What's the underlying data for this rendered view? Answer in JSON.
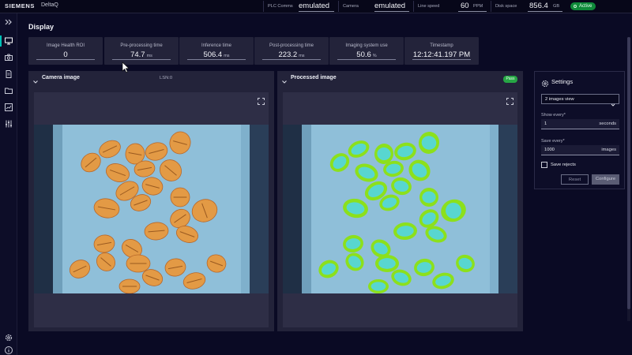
{
  "header": {
    "brand": "SIEMENS",
    "app_name": "DeltaQ",
    "stats": [
      {
        "label": "PLC Comms",
        "value": "emulated",
        "unit": ""
      },
      {
        "label": "Camera",
        "value": "emulated",
        "unit": ""
      },
      {
        "label": "Line speed",
        "value": "60",
        "unit": "PPM"
      },
      {
        "label": "Disk space",
        "value": "856.4",
        "unit": "GB"
      }
    ],
    "status_badge": "Active"
  },
  "sidebar": {
    "items": [
      {
        "icon": "expand-icon"
      },
      {
        "icon": "monitor-icon",
        "active": true
      },
      {
        "icon": "camera-icon"
      },
      {
        "icon": "document-icon"
      },
      {
        "icon": "folder-icon"
      },
      {
        "icon": "chart-icon"
      },
      {
        "icon": "sliders-icon"
      }
    ],
    "bottom_items": [
      {
        "icon": "gear-icon"
      },
      {
        "icon": "info-icon"
      }
    ]
  },
  "page": {
    "title": "Display"
  },
  "metrics": [
    {
      "label": "Image Health ROI",
      "value": "0",
      "unit": ""
    },
    {
      "label": "Pre-processing time",
      "value": "74.7",
      "unit": "ms"
    },
    {
      "label": "Inference time",
      "value": "506.4",
      "unit": "ms"
    },
    {
      "label": "Post-processing time",
      "value": "223.2",
      "unit": "ms"
    },
    {
      "label": "Imaging system use",
      "value": "50.6",
      "unit": "%"
    },
    {
      "label": "Timestamp",
      "value": "12:12:41.197 PM",
      "unit": ""
    }
  ],
  "panels": {
    "camera": {
      "title": "Camera image",
      "extra": "LSN:0"
    },
    "processed": {
      "title": "Processed image",
      "badge": "Pass"
    }
  },
  "settings": {
    "title": "Settings",
    "view_select": "2 images view",
    "show_every_label": "Show every*",
    "show_every_value": "1",
    "show_every_unit": "seconds",
    "save_every_label": "Save every*",
    "save_every_value": "1000",
    "save_every_unit": "images",
    "save_rejects_label": "Save rejects",
    "reset_label": "Reset",
    "configure_label": "Configure"
  },
  "colors": {
    "accent": "#00c1b6",
    "active": "#0f8a3a",
    "pass": "#27a745",
    "bean_raw": "#e39a45",
    "bean_processed_outer": "#8ce01c",
    "bean_processed_inner": "#58d6d0",
    "belt": "#8fbfd9"
  }
}
